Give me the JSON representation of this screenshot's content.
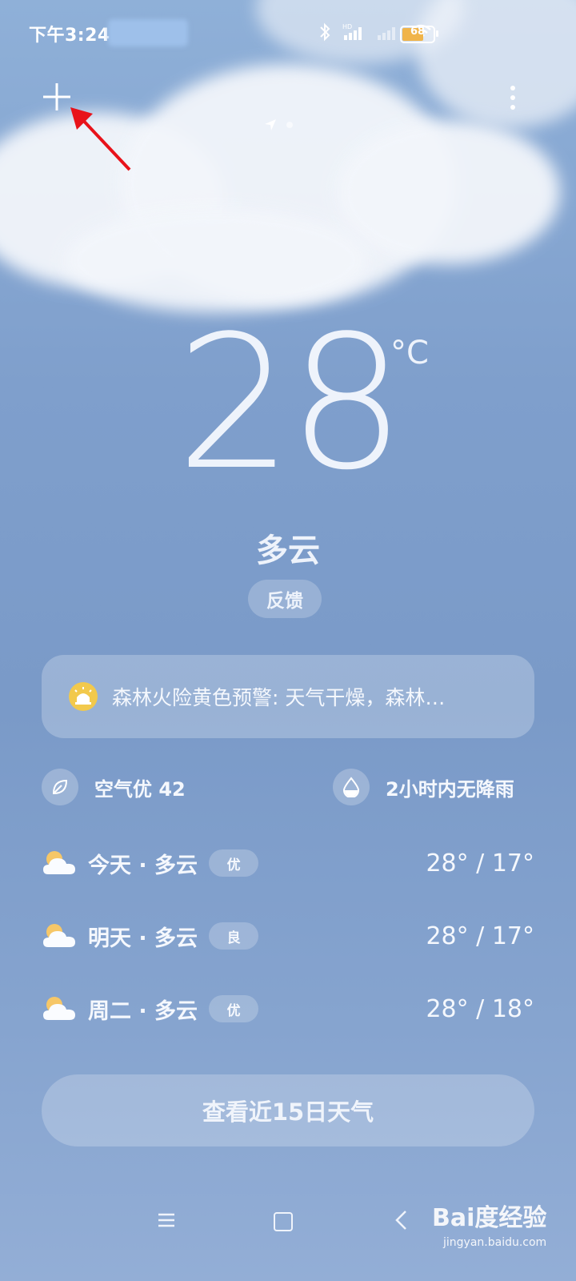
{
  "status_bar": {
    "time": "下午3:24",
    "battery": "68",
    "battery_color": "#f0b44a"
  },
  "header": {
    "add_icon": "plus-icon",
    "menu_icon": "more-vertical-icon",
    "location_icon": "location-arrow-icon"
  },
  "current": {
    "temperature": "28",
    "unit": "°C",
    "condition": "多云",
    "feedback_label": "反馈"
  },
  "alert": {
    "icon": "warning-siren-icon",
    "text": "森林火险黄色预警: 天气干燥，森林…",
    "color": "#f2c94c"
  },
  "info": {
    "air_quality": "空气优 42",
    "rain": "2小时内无降雨"
  },
  "forecast": [
    {
      "day": "今天 · 多云",
      "aqi": "优",
      "temps": "28° / 17°",
      "icon": "partly-cloudy-icon"
    },
    {
      "day": "明天 · 多云",
      "aqi": "良",
      "temps": "28° / 17°",
      "icon": "partly-cloudy-icon"
    },
    {
      "day": "周二 · 多云",
      "aqi": "优",
      "temps": "28° / 18°",
      "icon": "partly-cloudy-icon"
    }
  ],
  "button_15day": "查看近15日天气",
  "watermark": {
    "main": "Bai度经验",
    "sub": "jingyan.baidu.com"
  }
}
